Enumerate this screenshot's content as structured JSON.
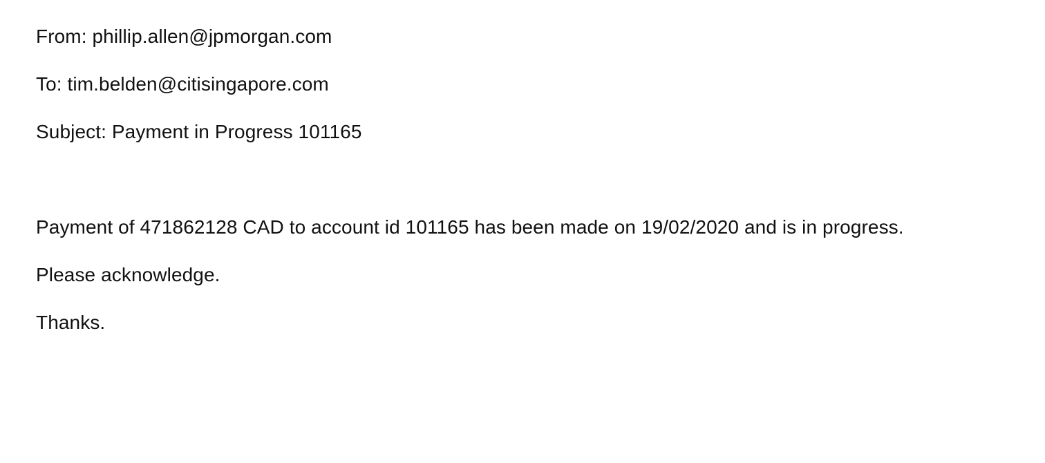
{
  "email": {
    "from_label": "From:",
    "from_value": "phillip.allen@jpmorgan.com",
    "to_label": "To:",
    "to_value": "tim.belden@citisingapore.com",
    "subject_label": "Subject:",
    "subject_value": "Payment in Progress 101165",
    "body": {
      "payment_line": "Payment of 471862128 CAD to account id 101165 has been made on 19/02/2020 and is in progress.",
      "acknowledge_line": "Please acknowledge.",
      "closing_line": "Thanks."
    }
  }
}
